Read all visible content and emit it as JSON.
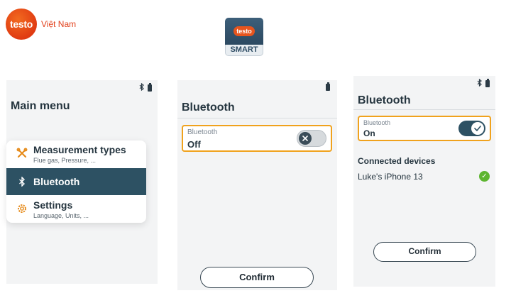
{
  "brand": {
    "logo_text": "testo",
    "region": "Việt Nam"
  },
  "app_icon": {
    "badge": "testo",
    "label": "SMART"
  },
  "screen_main_menu": {
    "title": "Main menu",
    "status": {
      "bluetooth_icon": "bluetooth-icon",
      "battery_icon": "battery-icon"
    },
    "items": [
      {
        "label": "Measurement types",
        "sub": "Flue gas, Pressure, ...",
        "icon": "wrench-cross-icon",
        "active": false
      },
      {
        "label": "Bluetooth",
        "sub": "",
        "icon": "bluetooth-icon",
        "active": true
      },
      {
        "label": "Settings",
        "sub": "Language, Units, ...",
        "icon": "gear-icon",
        "active": false
      }
    ]
  },
  "screen_bluetooth_off": {
    "title": "Bluetooth",
    "status": {
      "battery_icon": "battery-icon"
    },
    "field": {
      "label": "Bluetooth",
      "value": "Off",
      "toggle_state": "off"
    },
    "confirm_label": "Confirm"
  },
  "screen_bluetooth_on": {
    "title": "Bluetooth",
    "status": {
      "bluetooth_icon": "bluetooth-icon",
      "battery_icon": "battery-icon"
    },
    "field": {
      "label": "Bluetooth",
      "value": "On",
      "toggle_state": "on"
    },
    "connected_title": "Connected devices",
    "devices": [
      {
        "name": "Luke's iPhone 13",
        "status": "connected"
      }
    ],
    "confirm_label": "Confirm"
  },
  "colors": {
    "accent_orange": "#f0a21d",
    "active_item": "#2d5163",
    "brand_red": "#e2401b",
    "success_green": "#5db530"
  }
}
